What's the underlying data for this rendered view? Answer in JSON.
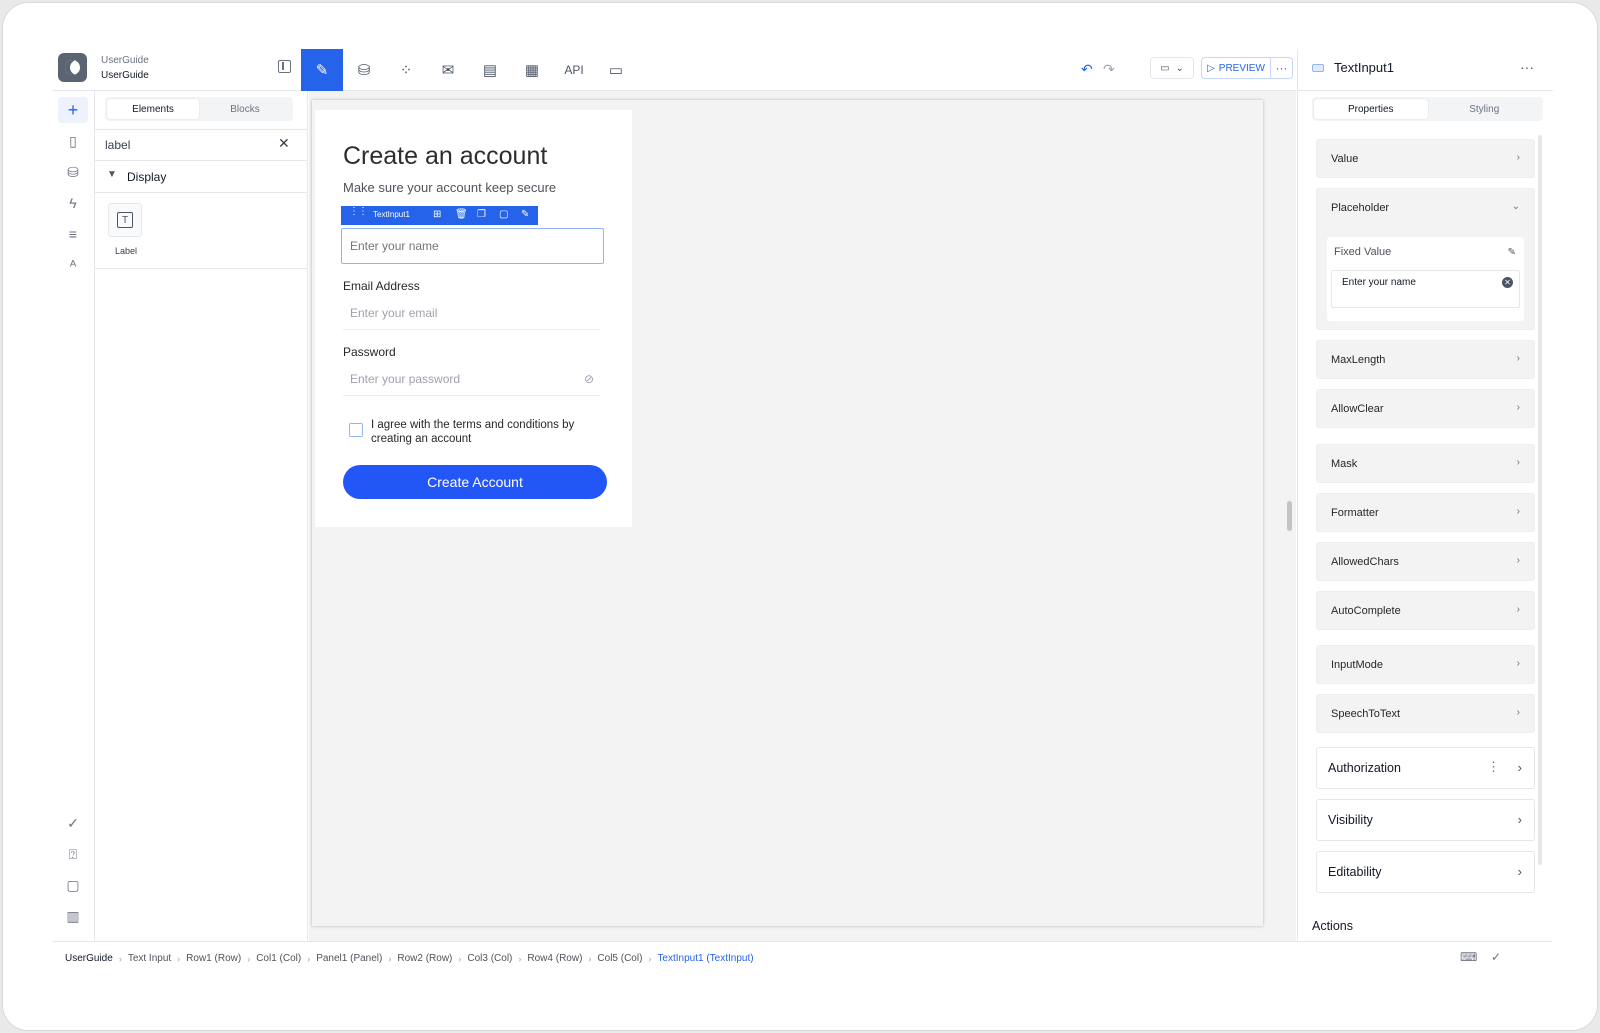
{
  "header": {
    "app_name": "UserGuide",
    "app_subtitle": "UserGuide",
    "api_label": "API",
    "preview_label": "PREVIEW",
    "more_label": "···"
  },
  "left_panel": {
    "tabs": [
      "Elements",
      "Blocks"
    ],
    "search_value": "label",
    "category": "Display",
    "widget_label": "Label"
  },
  "canvas": {
    "form_title": "Create an account",
    "form_subtitle": "Make sure your account keep secure",
    "selected_element": "TextInput1",
    "name_placeholder": "Enter your name",
    "email_label": "Email Address",
    "email_placeholder": "Enter your email",
    "password_label": "Password",
    "password_placeholder": "Enter your password",
    "terms_text": "I agree with the terms and conditions by creating an account",
    "cta_label": "Create Account"
  },
  "right_panel": {
    "title": "TextInput1",
    "tabs": [
      "Properties",
      "Styling"
    ],
    "properties": {
      "value": "Value",
      "placeholder": "Placeholder",
      "fixed_value_label": "Fixed Value",
      "fixed_value": "Enter your name",
      "maxlength": "MaxLength",
      "allowclear": "AllowClear",
      "mask": "Mask",
      "formatter": "Formatter",
      "allowedchars": "AllowedChars",
      "autocomplete": "AutoComplete",
      "inputmode": "InputMode",
      "speechtotext": "SpeechToText"
    },
    "sections": {
      "authorization": "Authorization",
      "visibility": "Visibility",
      "editability": "Editability",
      "actions": "Actions"
    }
  },
  "breadcrumb": [
    "UserGuide",
    "Text Input",
    "Row1 (Row)",
    "Col1 (Col)",
    "Panel1 (Panel)",
    "Row2 (Row)",
    "Col3 (Col)",
    "Row4 (Row)",
    "Col5 (Col)",
    "TextInput1 (TextInput)"
  ],
  "colors": {
    "accent": "#2563eb",
    "cta": "#2356f6",
    "canvas_bg": "#f3f3f4"
  }
}
